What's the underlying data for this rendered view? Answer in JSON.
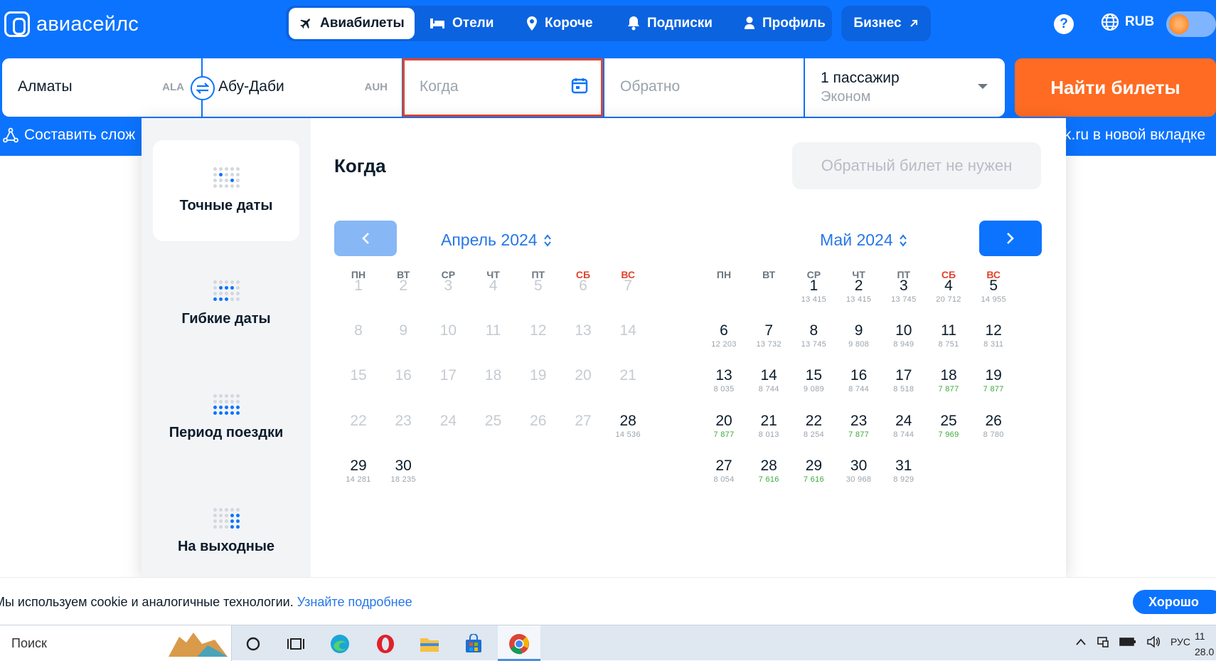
{
  "header": {
    "logo": "авиасейлс",
    "nav": [
      "Авиабилеты",
      "Отели",
      "Короче",
      "Подписки",
      "Профиль"
    ],
    "business": "Бизнес",
    "help": "?",
    "currency": "RUB"
  },
  "search": {
    "origin": {
      "city": "Алматы",
      "iata": "ALA"
    },
    "destination": {
      "city": "Абу-Даби",
      "iata": "AUH"
    },
    "when_placeholder": "Когда",
    "return_placeholder": "Обратно",
    "passengers": "1 пассажир",
    "cabin": "Эконом",
    "submit": "Найти билеты",
    "compose_link": "Составить слож",
    "newtab_link": "k.ru в новой вкладке"
  },
  "calendar": {
    "title": "Когда",
    "no_return": "Обратный билет не нужен",
    "modes": [
      "Точные даты",
      "Гибкие даты",
      "Период поездки",
      "На выходные"
    ],
    "weekdays": [
      "ПН",
      "ВТ",
      "СР",
      "ЧТ",
      "ПТ",
      "СБ",
      "ВС"
    ],
    "months": [
      {
        "title": "Апрель 2024"
      },
      {
        "title": "Май 2024"
      }
    ]
  },
  "cookie": {
    "text": "Мы используем cookie и аналогичные технологии.",
    "link": "Узнайте подробнее",
    "button": "Хорошо"
  },
  "taskbar": {
    "search": "Поиск",
    "lang": "РУС",
    "time": "11",
    "date": "28.0"
  },
  "colors": {
    "brand": "#0c73fe",
    "cta": "#ff6b22",
    "weekend": "#e3442c",
    "cheap": "#3aaa3a"
  }
}
